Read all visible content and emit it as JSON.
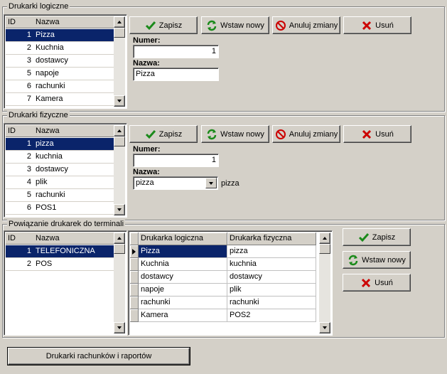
{
  "group1": {
    "title": "Drukarki logiczne",
    "list": {
      "headers": {
        "id": "ID",
        "name": "Nazwa"
      },
      "rows": [
        {
          "id": "1",
          "name": "Pizza"
        },
        {
          "id": "2",
          "name": "Kuchnia"
        },
        {
          "id": "3",
          "name": "dostawcy"
        },
        {
          "id": "5",
          "name": "napoje"
        },
        {
          "id": "6",
          "name": "rachunki"
        },
        {
          "id": "7",
          "name": "Kamera"
        }
      ]
    },
    "buttons": {
      "save": "Zapisz",
      "insert": "Wstaw nowy",
      "cancel": "Anuluj zmiany",
      "delete": "Usuń"
    },
    "numer_label": "Numer:",
    "numer_value": "1",
    "nazwa_label": "Nazwa:",
    "nazwa_value": "Pizza"
  },
  "group2": {
    "title": "Drukarki fizyczne",
    "list": {
      "headers": {
        "id": "ID",
        "name": "Nazwa"
      },
      "rows": [
        {
          "id": "1",
          "name": "pizza"
        },
        {
          "id": "2",
          "name": "kuchnia"
        },
        {
          "id": "3",
          "name": "dostawcy"
        },
        {
          "id": "4",
          "name": "plik"
        },
        {
          "id": "5",
          "name": "rachunki"
        },
        {
          "id": "6",
          "name": "POS1"
        }
      ]
    },
    "buttons": {
      "save": "Zapisz",
      "insert": "Wstaw nowy",
      "cancel": "Anuluj zmiany",
      "delete": "Usuń"
    },
    "numer_label": "Numer:",
    "numer_value": "1",
    "nazwa_label": "Nazwa:",
    "nazwa_value": "pizza",
    "nazwa_extra": "pizza"
  },
  "group3": {
    "title": "Powiązanie drukarek do terminali",
    "list": {
      "headers": {
        "id": "ID",
        "name": "Nazwa"
      },
      "rows": [
        {
          "id": "1",
          "name": "TELEFONICZNA"
        },
        {
          "id": "2",
          "name": "POS"
        }
      ]
    },
    "grid": {
      "headers": {
        "logical": "Drukarka logiczna",
        "physical": "Drukarka fizyczna"
      },
      "rows": [
        {
          "logical": "Pizza",
          "physical": "pizza"
        },
        {
          "logical": "Kuchnia",
          "physical": "kuchnia"
        },
        {
          "logical": "dostawcy",
          "physical": "dostawcy"
        },
        {
          "logical": "napoje",
          "physical": "plik"
        },
        {
          "logical": "rachunki",
          "physical": "rachunki"
        },
        {
          "logical": "Kamera",
          "physical": "POS2"
        }
      ]
    },
    "buttons": {
      "save": "Zapisz",
      "insert": "Wstaw nowy",
      "delete": "Usuń"
    }
  },
  "bottom_button": "Drukarki rachunków i raportów",
  "colors": {
    "selection": "#0a246a",
    "face": "#d4d0c8",
    "check": "#1a8a1a",
    "cancel": "#cc0000",
    "delete": "#cc0000"
  }
}
